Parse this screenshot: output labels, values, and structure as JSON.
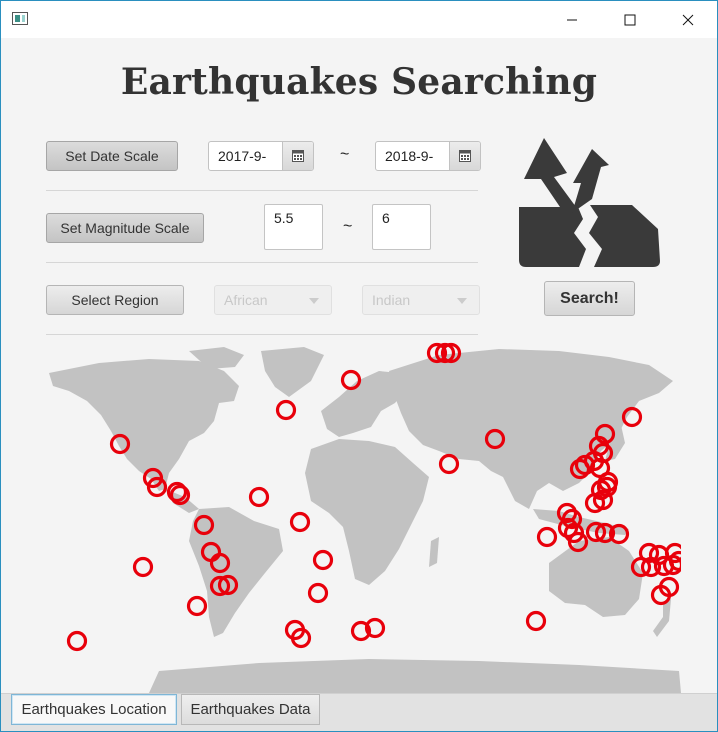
{
  "window": {
    "title": ""
  },
  "app": {
    "title": "Earthquakes Searching"
  },
  "date": {
    "button": "Set Date Scale",
    "start": "2017-9-",
    "end": "2018-9-",
    "separator": "~"
  },
  "magnitude": {
    "button": "Set Magnitude Scale",
    "min": "5.5",
    "max": "6",
    "separator": "~"
  },
  "region": {
    "button": "Select Region",
    "first": "African",
    "second": "Indian"
  },
  "search": {
    "label": "Search!"
  },
  "tabs": [
    {
      "label": "Earthquakes Location",
      "active": true
    },
    {
      "label": "Earthquakes Data",
      "active": false
    }
  ],
  "colors": {
    "marker": "#e8000b",
    "land": "#c2c2c2",
    "logo": "#3a3a3a",
    "accent": "#2a8fbf"
  },
  "icons": {
    "app": "app-icon",
    "calendar": "calendar-icon",
    "logo": "earthquake-logo-icon"
  }
}
